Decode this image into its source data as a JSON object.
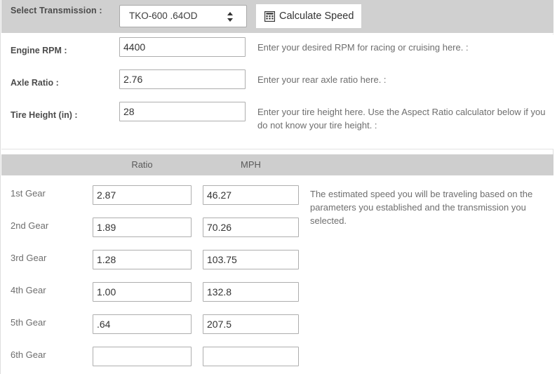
{
  "top_bar": {
    "label": "Select Transmission :",
    "select": {
      "value": "TKO-600 .64OD",
      "stepper_icon": "stepper-up-down-icon"
    },
    "calculate_button": {
      "label": "Calculate Speed",
      "icon": "calculator-icon"
    }
  },
  "parameters": [
    {
      "label": "Engine RPM :",
      "value": "4400",
      "placeholder": "",
      "help": "Enter your desired RPM for racing or cruising here. :"
    },
    {
      "label": "Axle Ratio :",
      "value": "2.76",
      "placeholder": "",
      "help": "Enter your rear axle ratio here. :"
    },
    {
      "label": "Tire Height (in) :",
      "value": "28",
      "placeholder": "",
      "help": "Enter your tire height here. Use the Aspect Ratio calculator below if you do not know your tire height. :"
    }
  ],
  "gear_table": {
    "columns": {
      "gear": "",
      "ratio": "Ratio",
      "mph": "MPH"
    },
    "rows": [
      {
        "gear": "1st Gear",
        "ratio": "2.87",
        "mph": "46.27"
      },
      {
        "gear": "2nd Gear",
        "ratio": "1.89",
        "mph": "70.26"
      },
      {
        "gear": "3rd Gear",
        "ratio": "1.28",
        "mph": "103.75"
      },
      {
        "gear": "4th Gear",
        "ratio": "1.00",
        "mph": "132.8"
      },
      {
        "gear": "5th Gear",
        "ratio": ".64",
        "mph": "207.5"
      },
      {
        "gear": "6th Gear",
        "ratio": "",
        "mph": ""
      }
    ],
    "note": "The estimated speed you will be traveling based on the parameters you established and the transmission you selected."
  },
  "colors": {
    "band_gray": "#d0d0d0",
    "header_gray": "#cecece",
    "label_text": "#4c4c4c",
    "help_text": "#6e6e6e",
    "input_border": "#aeaeae",
    "page_bg": "#ffffff"
  }
}
